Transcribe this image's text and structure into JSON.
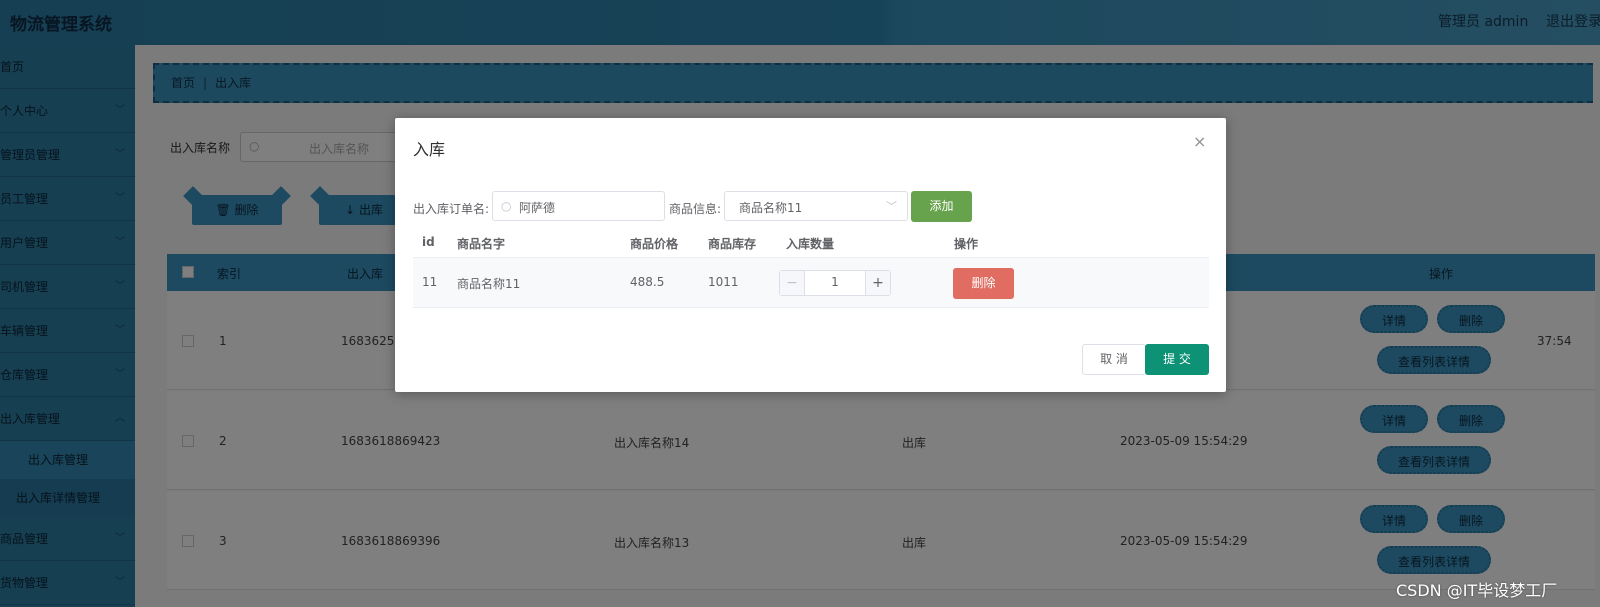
{
  "header": {
    "title": "物流管理系统",
    "user": "管理员 admin",
    "logout": "退出登录"
  },
  "sidebar": {
    "items": [
      {
        "label": "首页",
        "chevron": false
      },
      {
        "label": "个人中心",
        "chevron": true
      },
      {
        "label": "管理员管理",
        "chevron": true
      },
      {
        "label": "员工管理",
        "chevron": true
      },
      {
        "label": "用户管理",
        "chevron": true
      },
      {
        "label": "司机管理",
        "chevron": true
      },
      {
        "label": "车辆管理",
        "chevron": true
      },
      {
        "label": "仓库管理",
        "chevron": true
      },
      {
        "label": "出入库管理",
        "chevron": true
      }
    ],
    "subitems": [
      "出入库管理",
      "出入库详情管理"
    ],
    "after": [
      {
        "label": "商品管理"
      },
      {
        "label": "货物管理"
      }
    ]
  },
  "breadcrumb": {
    "home": "首页",
    "current": "出入库"
  },
  "search": {
    "label": "出入库名称",
    "placeholder": "出入库名称"
  },
  "toolbar": {
    "delete": "删除",
    "outbound": "出库"
  },
  "table": {
    "headers": {
      "index": "索引",
      "order": "出入库",
      "action": "操作"
    },
    "rows": [
      {
        "index": "1",
        "order": "1683625",
        "name": "",
        "type": "",
        "time": "37:54"
      },
      {
        "index": "2",
        "order": "1683618869423",
        "name": "出入库名称14",
        "type": "出库",
        "time": "2023-05-09 15:54:29"
      },
      {
        "index": "3",
        "order": "1683618869396",
        "name": "出入库名称13",
        "type": "出库",
        "time": "2023-05-09 15:54:29"
      }
    ],
    "row_buttons": {
      "detail": "详情",
      "delete": "删除",
      "list_detail": "查看列表详情"
    }
  },
  "modal": {
    "title": "入库",
    "close": "×",
    "order_label": "出入库订单名:",
    "order_value": "阿萨德",
    "goods_label": "商品信息:",
    "goods_value": "商品名称11",
    "add_btn": "添加",
    "columns": {
      "id": "id",
      "name": "商品名字",
      "price": "商品价格",
      "stock": "商品库存",
      "qty": "入库数量",
      "action": "操作"
    },
    "row": {
      "id": "11",
      "name": "商品名称11",
      "price": "488.5",
      "stock": "1011",
      "qty": "1",
      "delete": "删除"
    },
    "cancel": "取 消",
    "submit": "提 交"
  },
  "watermark": "CSDN @IT毕设梦工厂"
}
